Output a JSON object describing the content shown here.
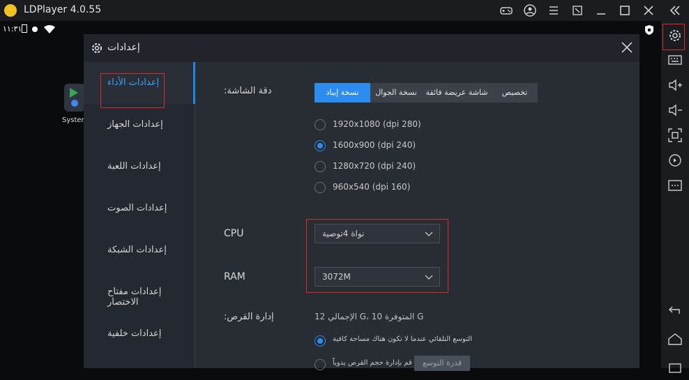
{
  "app": {
    "title": "LDPlayer 4.0.55"
  },
  "statusbar": {
    "time": "١١:٣١"
  },
  "desktop": {
    "app_label": "System"
  },
  "dialog": {
    "title": "إعدادات",
    "sidebar": [
      "إعدادات الأداء",
      "إعدادات الجهاز",
      "إعدادات اللعبة",
      "إعدادات الصوت",
      "إعدادات الشبكة",
      "إعدادات مفتاح الاختصار",
      "إعدادات خلفية"
    ],
    "resolution_label": ":دقة الشاشة",
    "resolution_tabs": [
      "نسخة إيباد",
      "نسخة الجوال",
      "شاشة عريضة فائقة",
      "تخصيص"
    ],
    "resolution_options": [
      "1920x1080  (dpi 280)",
      "1600x900  (dpi 240)",
      "1280x720  (dpi 240)",
      "960x540  (dpi 160)"
    ],
    "selected_resolution": "1600x900  (dpi 240)",
    "cpu": {
      "label": "CPU",
      "value": "نواة 4توصية"
    },
    "ram": {
      "label": "RAM",
      "value": "3072M"
    },
    "disk": {
      "label": ":إدارة القرص",
      "info": "12 الإجمالي G،  10 المتوفرة G",
      "option1": "التوسع التلقائي عندما لا تكون هناك مساحة كافية",
      "option2": "قم بإدارة حجم القرص يدوياً",
      "expand_button": "قدرة التوسع"
    }
  }
}
